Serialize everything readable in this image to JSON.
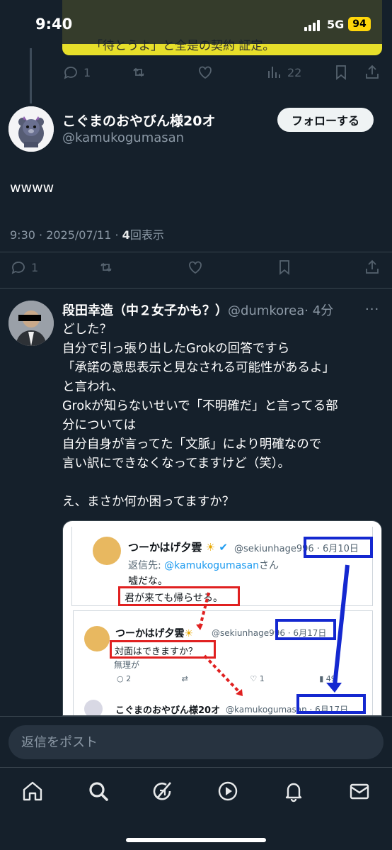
{
  "status_bar": {
    "time": "9:40",
    "network": "5G",
    "battery": "94"
  },
  "prev_tweet": {
    "peek_text": "「待とうよ」と全是の契約 証定。",
    "actions": {
      "replies": "1",
      "views": "22"
    }
  },
  "main_tweet": {
    "display_name": "こぐまのおやびん様20オ",
    "handle": "@kamukogumasan",
    "follow_label": "フォローする",
    "text": "wwww",
    "timestamp": "9:30 · 2025/07/11 · ",
    "views_count": "4",
    "views_label": "回表示",
    "actions": {
      "replies": "1"
    }
  },
  "reply_tweet": {
    "display_name": "段田幸造（中２女子かも？）",
    "handle": "@dumkorea",
    "age": "· 4分",
    "more": "···",
    "lines": [
      "どした？",
      "自分で引っ張り出したGrokの回答ですら",
      "「承諾の意思表示と見なされる可能性があるよ」",
      "と言われ、",
      "Grokが知らないせいで「不明確だ」と言ってる部",
      "分については",
      "自分自身が言ってた「文脈」により明確なので",
      "言い訳にできなくなってますけど（笑）。",
      "",
      "え、まさか何か困ってますか？"
    ],
    "media": {
      "t1": {
        "name": "つーかはげ夕雲",
        "handle": "@sekiunhage996 · 6月10日",
        "reply_to_prefix": "返信先: ",
        "reply_to": "@kamukogumasan",
        "reply_to_suffix": "さん",
        "line1": "嘘だな。",
        "boxed": "君が来ても帰らせる。"
      },
      "t2": {
        "name": "つーかはげ夕雲",
        "handle": "@sekiunhage996 · 6月17日",
        "boxed": "対面はできますか？",
        "line2": "無理が",
        "reply_count": "2",
        "like_count": "1",
        "views": "49"
      },
      "t3": {
        "name": "こぐまのおやびん様20オ",
        "handle": "@kamukogumasan · 6月17日"
      },
      "colors": {
        "red_box": "#e02020",
        "blue_box": "#1428d0",
        "verified": "#1d9bf0"
      }
    }
  },
  "reply_box": {
    "placeholder": "返信をポスト"
  },
  "nav": {
    "items": [
      "home-icon",
      "search-icon",
      "grok-icon",
      "video-icon",
      "notifications-icon",
      "messages-icon"
    ]
  }
}
